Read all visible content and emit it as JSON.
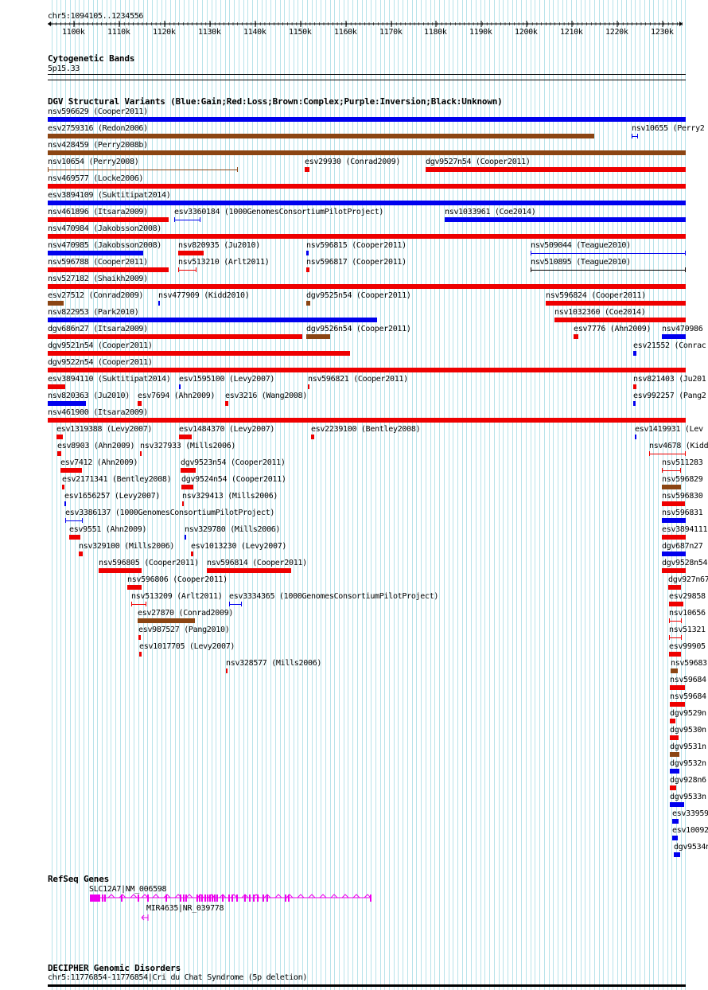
{
  "location": "chr5:1094105..1234556",
  "ruler_ticks": [
    "1100k",
    "1110k",
    "1120k",
    "1130k",
    "1140k",
    "1150k",
    "1160k",
    "1170k",
    "1180k",
    "1190k",
    "1200k",
    "1210k",
    "1220k",
    "1230k"
  ],
  "tracks": {
    "cytobands": {
      "title": "Cytogenetic Bands",
      "band": "5p15.33"
    },
    "dgv": {
      "title": "DGV Structural Variants (Blue:Gain;Red:Loss;Brown:Complex;Purple:Inversion;Black:Unknown)"
    },
    "refseq": {
      "title": "RefSeq Genes",
      "genes": [
        "SLC12A7|NM_006598",
        "MIR4635|NR_039778"
      ]
    },
    "decipher": {
      "title": "DECIPHER Genomic Disorders",
      "item": "chr5:11776854-11776854|Cri du Chat Syndrome (5p deletion)"
    }
  },
  "colors": {
    "gain": "#0000ee",
    "loss": "#ee0000",
    "complex": "#8b4513",
    "unknown": "#000000",
    "gene": "#ee00ee",
    "grid": "#b8e3ea"
  },
  "variants": [
    {
      "label": "nsv596629 (Cooper2011)",
      "type": "gain"
    },
    {
      "label": "esv2759316 (Redon2006)",
      "type": "complex"
    },
    {
      "label": "nsv10655 (Perry2",
      "type": "gain"
    },
    {
      "label": "nsv428459 (Perry2008b)",
      "type": "complex"
    },
    {
      "label": "nsv10654 (Perry2008)",
      "type": "complex"
    },
    {
      "label": "esv29930 (Conrad2009)",
      "type": "loss"
    },
    {
      "label": "dgv9527n54 (Cooper2011)",
      "type": "loss"
    },
    {
      "label": "nsv469577 (Locke2006)",
      "type": "loss"
    },
    {
      "label": "esv3894109 (Suktitipat2014)",
      "type": "gain"
    },
    {
      "label": "nsv461896 (Itsara2009)",
      "type": "loss"
    },
    {
      "label": "esv3360184 (1000GenomesConsortiumPilotProject)",
      "type": "gain"
    },
    {
      "label": "nsv1033961 (Coe2014)",
      "type": "gain"
    },
    {
      "label": "nsv470984 (Jakobsson2008)",
      "type": "loss"
    },
    {
      "label": "nsv470985 (Jakobsson2008)",
      "type": "gain"
    },
    {
      "label": "nsv820935 (Ju2010)",
      "type": "loss"
    },
    {
      "label": "nsv596815 (Cooper2011)",
      "type": "gain"
    },
    {
      "label": "nsv509044 (Teague2010)",
      "type": "gain"
    },
    {
      "label": "nsv596788 (Cooper2011)",
      "type": "loss"
    },
    {
      "label": "nsv513210 (Arlt2011)",
      "type": "loss"
    },
    {
      "label": "nsv596817 (Cooper2011)",
      "type": "loss"
    },
    {
      "label": "nsv510895 (Teague2010)",
      "type": "unknown"
    },
    {
      "label": "nsv527182 (Shaikh2009)",
      "type": "loss"
    },
    {
      "label": "esv27512 (Conrad2009)",
      "type": "complex"
    },
    {
      "label": "nsv477909 (Kidd2010)",
      "type": "gain"
    },
    {
      "label": "dgv9525n54 (Cooper2011)",
      "type": "complex"
    },
    {
      "label": "nsv596824 (Cooper2011)",
      "type": "loss"
    },
    {
      "label": "nsv822953 (Park2010)",
      "type": "gain"
    },
    {
      "label": "nsv1032360 (Coe2014)",
      "type": "loss"
    },
    {
      "label": "dgv686n27 (Itsara2009)",
      "type": "loss"
    },
    {
      "label": "dgv9526n54 (Cooper2011)",
      "type": "complex"
    },
    {
      "label": "esv7776 (Ahn2009)",
      "type": "loss"
    },
    {
      "label": "nsv470986",
      "type": "gain"
    },
    {
      "label": "dgv9521n54 (Cooper2011)",
      "type": "loss"
    },
    {
      "label": "esv21552 (Conrac",
      "type": "gain"
    },
    {
      "label": "dgv9522n54 (Cooper2011)",
      "type": "loss"
    },
    {
      "label": "esv3894110 (Suktitipat2014)",
      "type": "loss"
    },
    {
      "label": "esv1595100 (Levy2007)",
      "type": "gain"
    },
    {
      "label": "nsv596821 (Cooper2011)",
      "type": "loss"
    },
    {
      "label": "nsv821403 (Ju201",
      "type": "loss"
    },
    {
      "label": "nsv820363 (Ju2010)",
      "type": "gain"
    },
    {
      "label": "esv7694 (Ahn2009)",
      "type": "loss"
    },
    {
      "label": "esv3216 (Wang2008)",
      "type": "loss"
    },
    {
      "label": "esv992257 (Pang2",
      "type": "gain"
    },
    {
      "label": "nsv461900 (Itsara2009)",
      "type": "loss"
    },
    {
      "label": "esv1319388 (Levy2007)",
      "type": "loss"
    },
    {
      "label": "esv1484370 (Levy2007)",
      "type": "loss"
    },
    {
      "label": "esv2239100 (Bentley2008)",
      "type": "loss"
    },
    {
      "label": "esv1419931 (Lev",
      "type": "gain"
    },
    {
      "label": "esv8903 (Ahn2009)",
      "type": "loss"
    },
    {
      "label": "nsv327933 (Mills2006)",
      "type": "loss"
    },
    {
      "label": "nsv4678 (Kidd",
      "type": "loss"
    },
    {
      "label": "esv7412 (Ahn2009)",
      "type": "loss"
    },
    {
      "label": "dgv9523n54 (Cooper2011)",
      "type": "loss"
    },
    {
      "label": "nsv511283",
      "type": "loss"
    },
    {
      "label": "esv2171341 (Bentley2008)",
      "type": "loss"
    },
    {
      "label": "dgv9524n54 (Cooper2011)",
      "type": "loss"
    },
    {
      "label": "nsv596829",
      "type": "complex"
    },
    {
      "label": "esv1656257 (Levy2007)",
      "type": "gain"
    },
    {
      "label": "nsv329413 (Mills2006)",
      "type": "loss"
    },
    {
      "label": "nsv596830",
      "type": "loss"
    },
    {
      "label": "esv3386137 (1000GenomesConsortiumPilotProject)",
      "type": "gain"
    },
    {
      "label": "nsv596831",
      "type": "gain"
    },
    {
      "label": "esv9551 (Ahn2009)",
      "type": "loss"
    },
    {
      "label": "nsv329780 (Mills2006)",
      "type": "gain"
    },
    {
      "label": "esv3894111",
      "type": "loss"
    },
    {
      "label": "nsv329100 (Mills2006)",
      "type": "loss"
    },
    {
      "label": "esv1013230 (Levy2007)",
      "type": "loss"
    },
    {
      "label": "dgv687n27",
      "type": "gain"
    },
    {
      "label": "nsv596805 (Cooper2011)",
      "type": "loss"
    },
    {
      "label": "nsv596814 (Cooper2011)",
      "type": "loss"
    },
    {
      "label": "dgv9528n54",
      "type": "loss"
    },
    {
      "label": "nsv596806 (Cooper2011)",
      "type": "loss"
    },
    {
      "label": "dgv927n67",
      "type": "loss"
    },
    {
      "label": "nsv513209 (Arlt2011)",
      "type": "loss"
    },
    {
      "label": "esv3334365 (1000GenomesConsortiumPilotProject)",
      "type": "gain"
    },
    {
      "label": "esv29858",
      "type": "loss"
    },
    {
      "label": "esv27870 (Conrad2009)",
      "type": "complex"
    },
    {
      "label": "nsv10656",
      "type": "loss"
    },
    {
      "label": "esv987527 (Pang2010)",
      "type": "loss"
    },
    {
      "label": "nsv51321",
      "type": "loss"
    },
    {
      "label": "esv1017705 (Levy2007)",
      "type": "loss"
    },
    {
      "label": "esv99905",
      "type": "loss"
    },
    {
      "label": "nsv328577 (Mills2006)",
      "type": "loss"
    },
    {
      "label": "nsv59683",
      "type": "complex"
    },
    {
      "label": "nsv59684",
      "type": "loss"
    },
    {
      "label": "nsv59684",
      "type": "loss"
    },
    {
      "label": "dgv9529n",
      "type": "loss"
    },
    {
      "label": "dgv9530n",
      "type": "loss"
    },
    {
      "label": "dgv9531n",
      "type": "complex"
    },
    {
      "label": "dgv9532n",
      "type": "gain"
    },
    {
      "label": "dgv928n6",
      "type": "loss"
    },
    {
      "label": "dgv9533n",
      "type": "gain"
    },
    {
      "label": "esv33959",
      "type": "gain"
    },
    {
      "label": "esv10092",
      "type": "gain"
    },
    {
      "label": "dgv9534n",
      "type": "gain"
    }
  ]
}
